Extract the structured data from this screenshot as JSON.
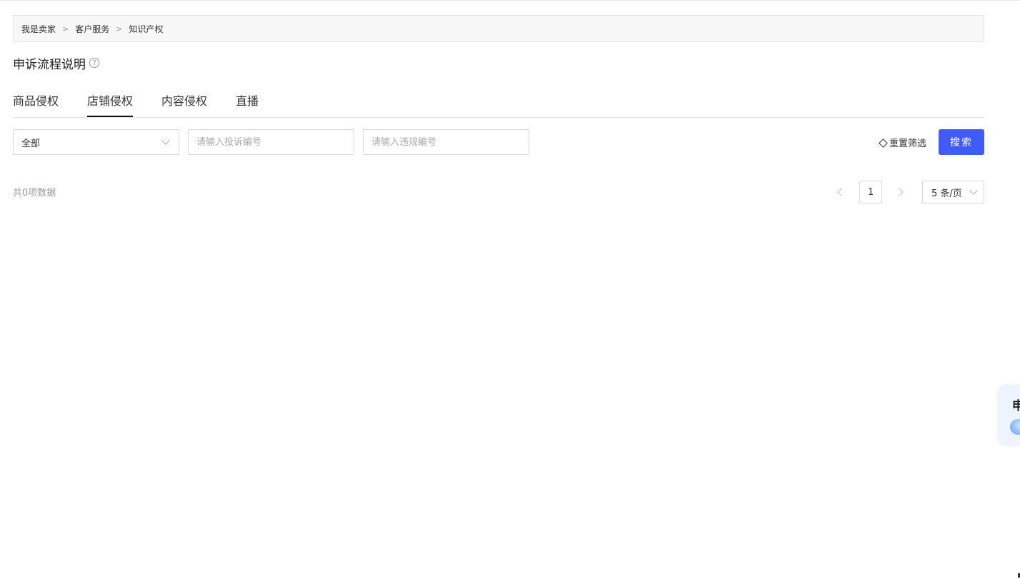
{
  "breadcrumb": {
    "items": [
      "我是卖家",
      "客户服务",
      "知识产权"
    ],
    "separator": ">"
  },
  "header": {
    "title": "申诉流程说明",
    "help_icon": "question-circle-icon",
    "help_glyph": "?"
  },
  "tabs": [
    {
      "label": "商品侵权",
      "active": false
    },
    {
      "label": "店铺侵权",
      "active": true
    },
    {
      "label": "内容侵权",
      "active": false
    },
    {
      "label": "直播",
      "active": false
    }
  ],
  "filters": {
    "status_select": {
      "value": "全部"
    },
    "complaint_no": {
      "placeholder": "请输入投诉编号",
      "value": ""
    },
    "violation_no": {
      "placeholder": "请输入违规编号",
      "value": ""
    },
    "reset_label": "重置筛选",
    "search_label": "搜索"
  },
  "results": {
    "total_text": "共0项数据"
  },
  "pagination": {
    "current_page": "1",
    "page_size": "5 条/页"
  },
  "float_widget": {
    "text": "申"
  },
  "colors": {
    "primary": "#3f5bfa",
    "breadcrumb_bg": "#f7f7f7",
    "muted_text": "#999999"
  }
}
